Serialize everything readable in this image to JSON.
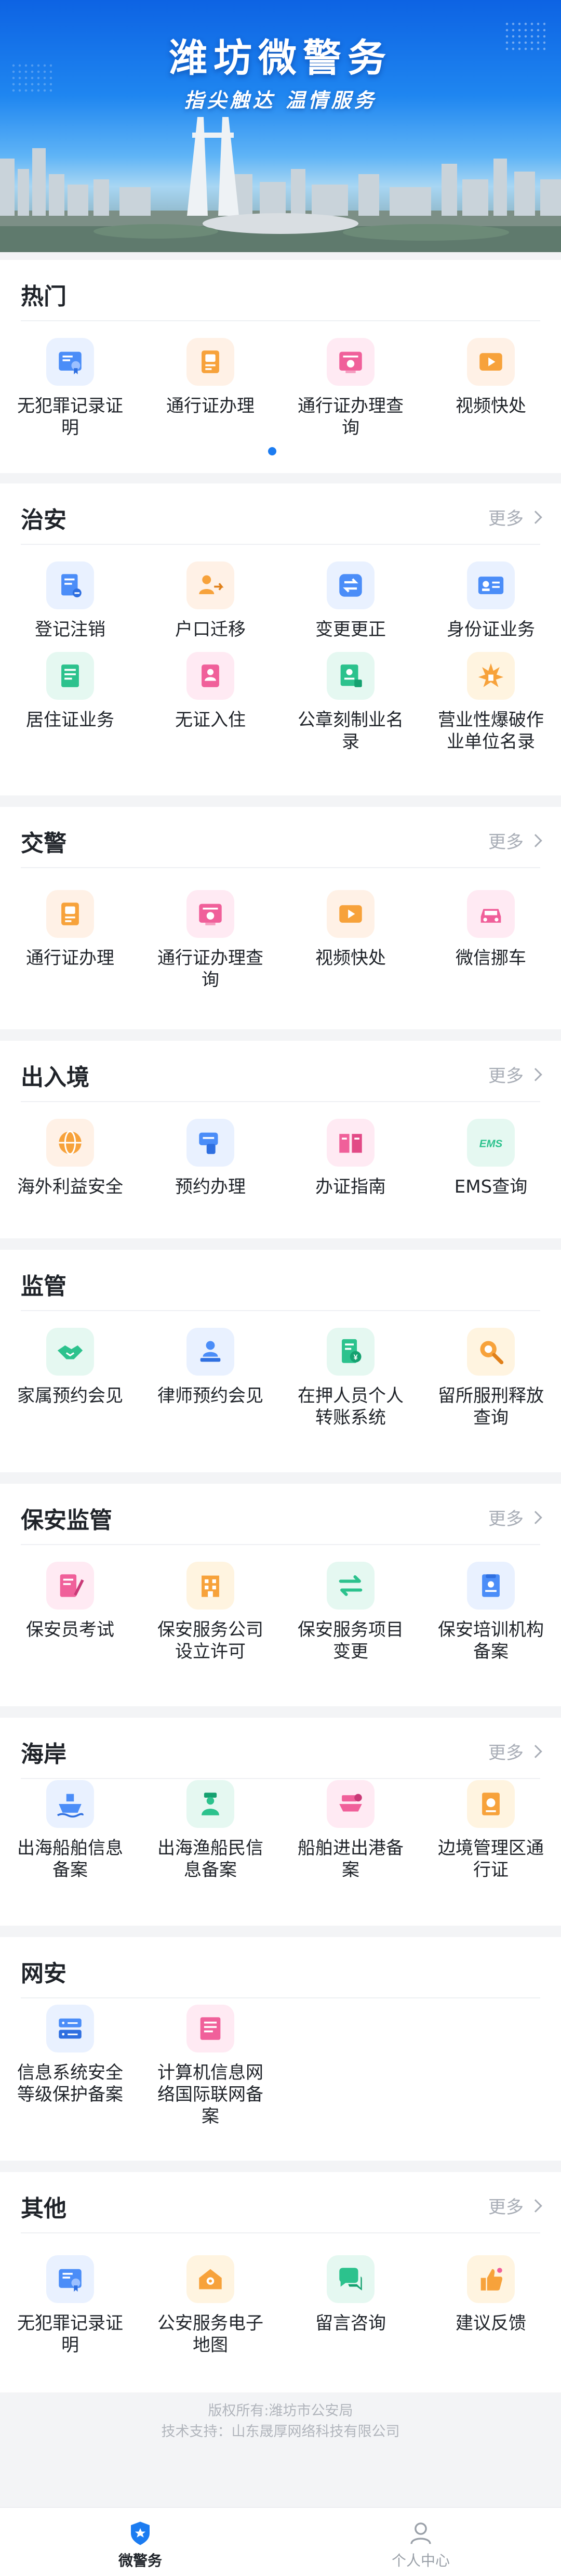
{
  "banner": {
    "title": "潍坊微警务",
    "slogan": "指尖触达 温情服务"
  },
  "more_label": "更多",
  "sections": {
    "hot": {
      "title": "热门",
      "items": [
        {
          "label": "无犯罪记录证明",
          "icon": "certificate-icon"
        },
        {
          "label": "通行证办理",
          "icon": "pass-icon"
        },
        {
          "label": "通行证办理查询",
          "icon": "pass-query-icon"
        },
        {
          "label": "视频快处",
          "icon": "video-icon"
        }
      ]
    },
    "zhian": {
      "title": "治安",
      "items": [
        {
          "label": "登记注销",
          "icon": "register-cancel-icon"
        },
        {
          "label": "户口迁移",
          "icon": "household-move-icon"
        },
        {
          "label": "变更更正",
          "icon": "change-correct-icon"
        },
        {
          "label": "身份证业务",
          "icon": "id-card-icon"
        },
        {
          "label": "居住证业务",
          "icon": "residence-permit-icon"
        },
        {
          "label": "无证入住",
          "icon": "no-id-checkin-icon"
        },
        {
          "label": "公章刻制业名录",
          "icon": "seal-engraving-icon"
        },
        {
          "label": "营业性爆破作业单位名录",
          "icon": "blasting-icon"
        }
      ]
    },
    "jiaojing": {
      "title": "交警",
      "items": [
        {
          "label": "通行证办理",
          "icon": "pass-icon"
        },
        {
          "label": "通行证办理查询",
          "icon": "pass-query-icon"
        },
        {
          "label": "视频快处",
          "icon": "video-icon"
        },
        {
          "label": "微信挪车",
          "icon": "car-move-icon"
        }
      ]
    },
    "churujing": {
      "title": "出入境",
      "items": [
        {
          "label": "海外利益安全",
          "icon": "globe-icon"
        },
        {
          "label": "预约办理",
          "icon": "appointment-icon"
        },
        {
          "label": "办证指南",
          "icon": "guide-book-icon"
        },
        {
          "label": "EMS查询",
          "icon": "ems-icon",
          "badge": "EMS"
        }
      ]
    },
    "jianguan": {
      "title": "监管",
      "items": [
        {
          "label": "家属预约会见",
          "icon": "handshake-icon"
        },
        {
          "label": "律师预约会见",
          "icon": "lawyer-icon"
        },
        {
          "label": "在押人员个人转账系统",
          "icon": "transfer-icon"
        },
        {
          "label": "留所服刑释放查询",
          "icon": "release-query-icon"
        }
      ]
    },
    "baoan": {
      "title": "保安监管",
      "items": [
        {
          "label": "保安员考试",
          "icon": "exam-icon"
        },
        {
          "label": "保安服务公司设立许可",
          "icon": "company-license-icon"
        },
        {
          "label": "保安服务项目变更",
          "icon": "swap-icon"
        },
        {
          "label": "保安培训机构备案",
          "icon": "training-icon"
        }
      ]
    },
    "haian": {
      "title": "海岸",
      "items": [
        {
          "label": "出海船舶信息备案",
          "icon": "ship-icon"
        },
        {
          "label": "出海渔船民信息备案",
          "icon": "fisherman-icon"
        },
        {
          "label": "船舶进出港备案",
          "icon": "port-icon"
        },
        {
          "label": "边境管理区通行证",
          "icon": "border-pass-icon"
        }
      ]
    },
    "wangan": {
      "title": "网安",
      "items": [
        {
          "label": "信息系统安全等级保护备案",
          "icon": "server-icon"
        },
        {
          "label": "计算机信息网络国际联网备案",
          "icon": "network-icon"
        }
      ]
    },
    "qita": {
      "title": "其他",
      "items": [
        {
          "label": "无犯罪记录证明",
          "icon": "certificate-icon"
        },
        {
          "label": "公安服务电子地图",
          "icon": "map-home-icon"
        },
        {
          "label": "留言咨询",
          "icon": "chat-icon"
        },
        {
          "label": "建议反馈",
          "icon": "feedback-icon"
        }
      ]
    }
  },
  "footer": {
    "copyright": "版权所有:潍坊市公安局",
    "tech_support": "技术支持：山东晟厚网络科技有限公司"
  },
  "tabbar": {
    "home": "微警务",
    "profile": "个人中心"
  },
  "colors": {
    "accent": "#1c7cf1",
    "blue_icon": "#4b8df8",
    "orange_icon": "#f7a23b",
    "pink_icon": "#f0609a",
    "green_icon": "#2cc28d"
  }
}
